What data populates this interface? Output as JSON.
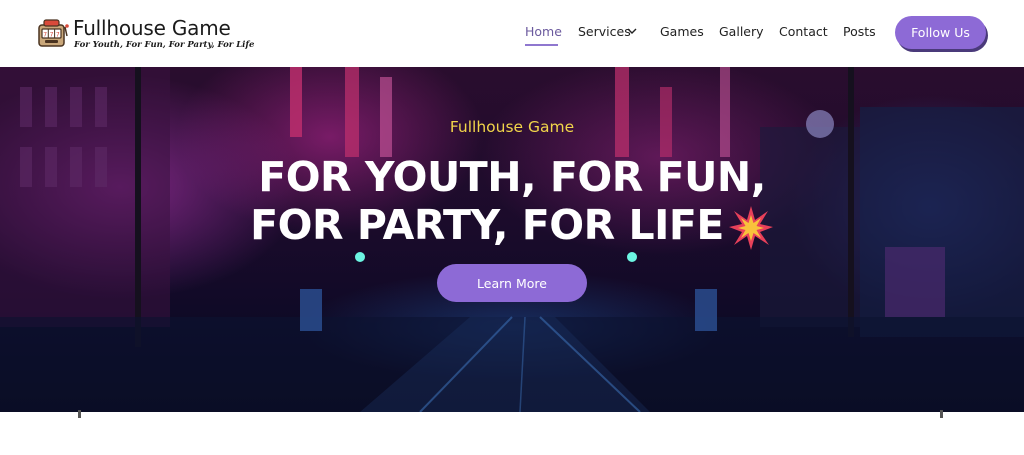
{
  "header": {
    "logo_title": "Fullhouse Game",
    "logo_tagline": "For Youth, For Fun, For Party, For Life",
    "logo_icon": "slot-machine-icon",
    "nav": [
      {
        "label": "Home",
        "active": true
      },
      {
        "label": "Services",
        "has_dropdown": true
      },
      {
        "label": "Games"
      },
      {
        "label": "Gallery"
      },
      {
        "label": "Contact"
      },
      {
        "label": "Posts"
      }
    ],
    "follow_label": "Follow Us"
  },
  "hero": {
    "subtitle": "Fullhouse Game",
    "headline_line1": "FOR YOUTH, FOR FUN,",
    "headline_line2": "FOR PARTY, FOR LIFE",
    "burst_icon": "explosion-icon",
    "cta_label": "Learn More"
  },
  "colors": {
    "accent": "#8d6ad6",
    "active_nav": "#6b5a9e",
    "subtitle": "#f1d54a",
    "burst": "#e8405a"
  }
}
